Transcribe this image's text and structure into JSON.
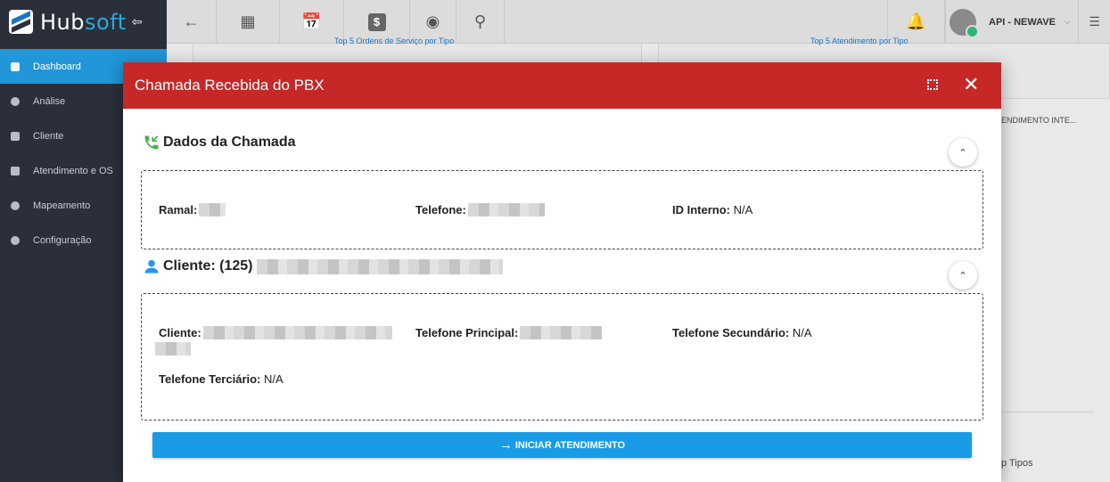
{
  "app": {
    "logo_main": "Hub",
    "logo_accent": "soft"
  },
  "sidebar": {
    "items": [
      {
        "label": "Dashboard",
        "active": true
      },
      {
        "label": "Análise"
      },
      {
        "label": "Cliente"
      },
      {
        "label": "Atendimento e OS"
      },
      {
        "label": "Mapeamento"
      },
      {
        "label": "Configuração"
      }
    ]
  },
  "topbar": {
    "icons": [
      "back-arrow-icon",
      "contact-card-icon",
      "calendar-clock-icon",
      "dollar-icon",
      "eye-icon",
      "search-icon",
      "bell-alert-icon",
      "list-menu-icon"
    ],
    "user_name": "API - NEWAVE",
    "alert_color": "#e53935"
  },
  "background": {
    "card_left_title": "Top 5 Ordens de Serviço por Tipo",
    "card_right_title": "Top 5 Atendimento por Tipo",
    "right_text_1": "ENDIMENTO INTE...",
    "right_text_2": "p Tipos"
  },
  "modal": {
    "title": "Chamada Recebida do PBX",
    "header_color": "#c62828",
    "call_section": {
      "title": "Dados da Chamada",
      "ramal_label": "Ramal:",
      "telefone_label": "Telefone:",
      "id_label": "ID Interno:",
      "id_value": "N/A"
    },
    "client_section": {
      "title": "Cliente: (125)",
      "cliente_label": "Cliente:",
      "tel_principal_label": "Telefone Principal:",
      "tel_secundario_label": "Telefone Secundário:",
      "tel_secundario_value": "N/A",
      "tel_terciario_label": "Telefone Terciário:",
      "tel_terciario_value": "N/A"
    },
    "start_button": "INICIAR ATENDIMENTO"
  }
}
